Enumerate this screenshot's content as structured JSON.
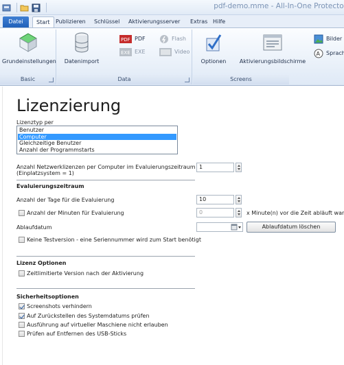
{
  "window": {
    "title": "pdf-demo.mme - All-In-One Protector"
  },
  "tabs": [
    {
      "label": "Datei"
    },
    {
      "label": "Start"
    },
    {
      "label": "Publizieren"
    },
    {
      "label": "Schlüssel"
    },
    {
      "label": "Aktivierungsserver"
    },
    {
      "label": "Extras"
    },
    {
      "label": "Hilfe"
    }
  ],
  "ribbon": {
    "basic": {
      "label": "Basic",
      "grundeinstellungen": "Grundeinstellungen"
    },
    "data": {
      "label": "Data",
      "datenimport": "Datenimport",
      "pdf": "PDF",
      "exe": "EXE",
      "flash": "Flash",
      "video": "Video"
    },
    "screens": {
      "label": "Screens",
      "optionen": "Optionen",
      "aktivierungsbildschirme": "Aktivierungsbildschirme",
      "bilder": "Bilder",
      "sprachen": "Sprachen"
    }
  },
  "page": {
    "title": "Lizenzierung"
  },
  "lizenztyp": {
    "label": "Lizenztyp per",
    "options": [
      "Benutzer",
      "Computer",
      "Gleichzeitige Benutzer",
      "Anzahl der Programmstarts"
    ],
    "selected_index": 1
  },
  "netzwerk": {
    "label_line1": "Anzahl Netzwerklizenzen per Computer im Evaluierungszeitraum",
    "label_line2": "(Einplatzsystem = 1)",
    "value": "1"
  },
  "evaluierung": {
    "header": "Evaluierungszeitraum",
    "tage_label": "Anzahl der Tage für die Evaluierung",
    "tage_value": "10",
    "minuten_label": "Anzahl der Minuten für Evaluierung",
    "minuten_value": "0",
    "minuten_suffix": "x Minute(n) vor die Zeit abläuft warnen",
    "ablaufdatum_label": "Ablaufdatum",
    "ablaufdatum_button": "Ablaufdatum löschen",
    "keine_testversion": "Keine Testversion - eine Seriennummer wird zum Start benötigt"
  },
  "lizenz_optionen": {
    "header": "Lizenz Optionen",
    "zeitlimitiert": "Zeitlimitierte Version nach der Aktivierung"
  },
  "sicherheit": {
    "header": "Sicherheitsoptionen",
    "screenshots": "Screenshots verhindern",
    "systemdatum": "Auf Zurückstellen des Systemdatums prüfen",
    "virtuell": "Ausführung auf virtueller Maschiene nicht erlauben",
    "usb": "Prüfen auf Entfernen des USB-Sticks"
  },
  "colors": {
    "accent": "#3399ff",
    "file_tab": "#2b6cc4"
  }
}
